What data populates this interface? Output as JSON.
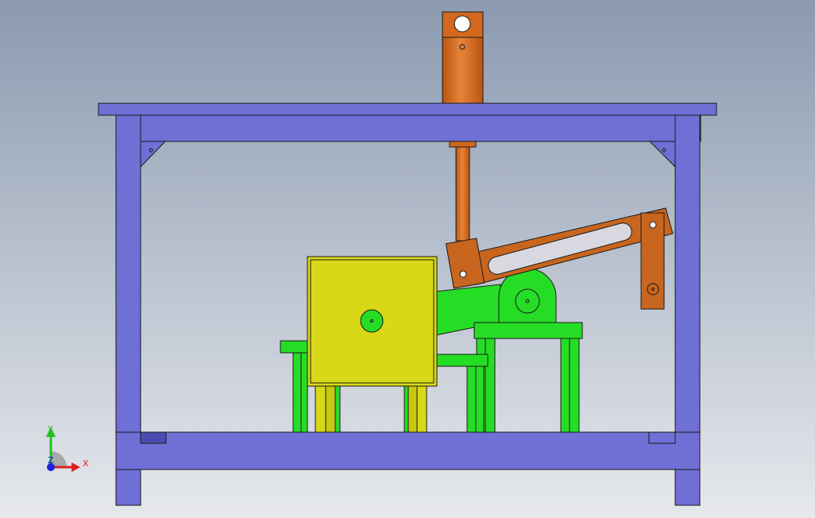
{
  "viewport": {
    "background_top": "#8b9ab0",
    "background_bottom": "#e6e8ec"
  },
  "colors": {
    "frame": "#6f6fd6",
    "frame_dark": "#4c4cb0",
    "cylinder": "#d2691e",
    "cylinder_light": "#e8843a",
    "linkage": "#c8651e",
    "bracket": "#26dd26",
    "box": "#d8d818",
    "outline": "#1a1a1a"
  },
  "triad": {
    "x_label": "X",
    "y_label": "Y",
    "z_label": "Z",
    "x_color": "#e02020",
    "y_color": "#20c020",
    "z_color": "#2020e0"
  }
}
